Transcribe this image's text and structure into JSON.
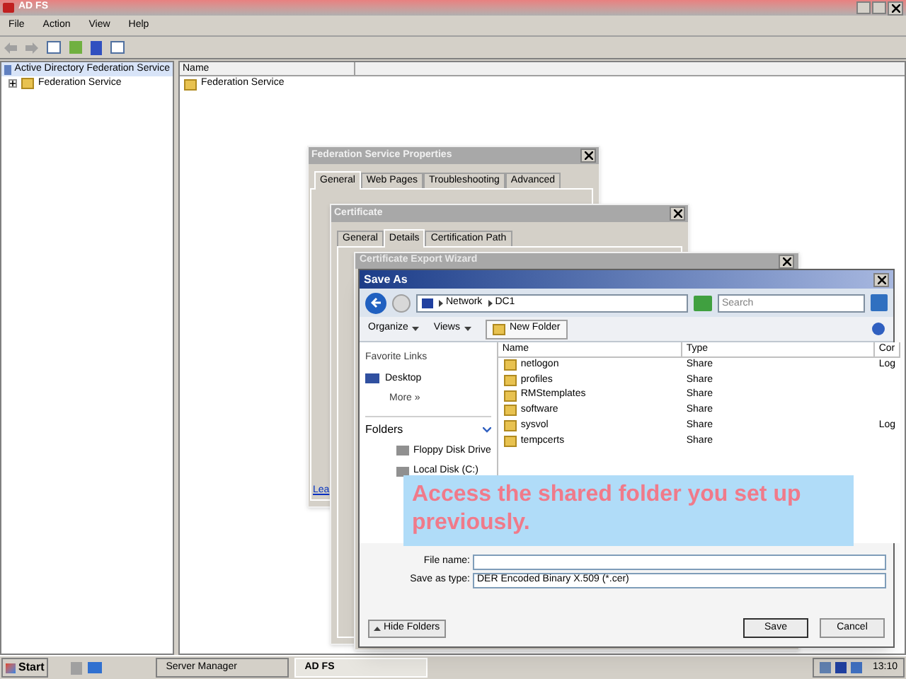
{
  "main_window": {
    "title": "AD FS",
    "menu": [
      "File",
      "Action",
      "View",
      "Help"
    ],
    "tree": {
      "root": "Active Directory Federation Service",
      "children": [
        {
          "label": "Federation Service",
          "expanded": false
        }
      ]
    },
    "list": {
      "columns": [
        "Name"
      ],
      "rows": [
        "Federation Service"
      ]
    }
  },
  "properties_dialog": {
    "title": "Federation Service Properties",
    "tabs": [
      {
        "label": "General",
        "selected": true
      },
      {
        "label": "Web Pages",
        "selected": false
      },
      {
        "label": "Troubleshooting",
        "selected": false
      },
      {
        "label": "Advanced",
        "selected": false
      }
    ],
    "link": "Lea"
  },
  "certificate_dialog": {
    "title": "Certificate",
    "tabs": [
      {
        "label": "General",
        "selected": false
      },
      {
        "label": "Details",
        "selected": true
      },
      {
        "label": "Certification Path",
        "selected": false
      }
    ]
  },
  "wizard": {
    "title": "Certificate Export Wizard"
  },
  "save_as": {
    "title": "Save As",
    "breadcrumb": [
      "Network",
      "DC1"
    ],
    "search": {
      "placeholder": "Search"
    },
    "toolbar": [
      "Organize",
      "Views",
      "New Folder"
    ],
    "favorites_heading": "Favorite Links",
    "favorites": [
      "Desktop"
    ],
    "more": "More",
    "more_glyph": "»",
    "folders_heading": "Folders",
    "folders": [
      "Floppy Disk Drive",
      "Local Disk (C:)"
    ],
    "columns": [
      "Name",
      "Type",
      "Cor"
    ],
    "rows": [
      {
        "name": "netlogon",
        "type": "Share",
        "comment": "Log"
      },
      {
        "name": "profiles",
        "type": "Share",
        "comment": ""
      },
      {
        "name": "RMStemplates",
        "type": "Share",
        "comment": ""
      },
      {
        "name": "software",
        "type": "Share",
        "comment": ""
      },
      {
        "name": "sysvol",
        "type": "Share",
        "comment": "Log"
      },
      {
        "name": "tempcerts",
        "type": "Share",
        "comment": ""
      }
    ],
    "file_name_label": "File name:",
    "save_type_label": "Save as type:",
    "save_type_value": "DER Encoded Binary X.509 (*.cer)",
    "hide_folders": "Hide Folders",
    "buttons": [
      "Save",
      "Cancel"
    ]
  },
  "callout": "Access the shared folder you set up previously.",
  "taskbar": {
    "start": "Start",
    "tasks": [
      {
        "label": "Server Manager",
        "selected": false
      },
      {
        "label": "AD FS",
        "selected": true
      }
    ],
    "clock": "13:10"
  }
}
